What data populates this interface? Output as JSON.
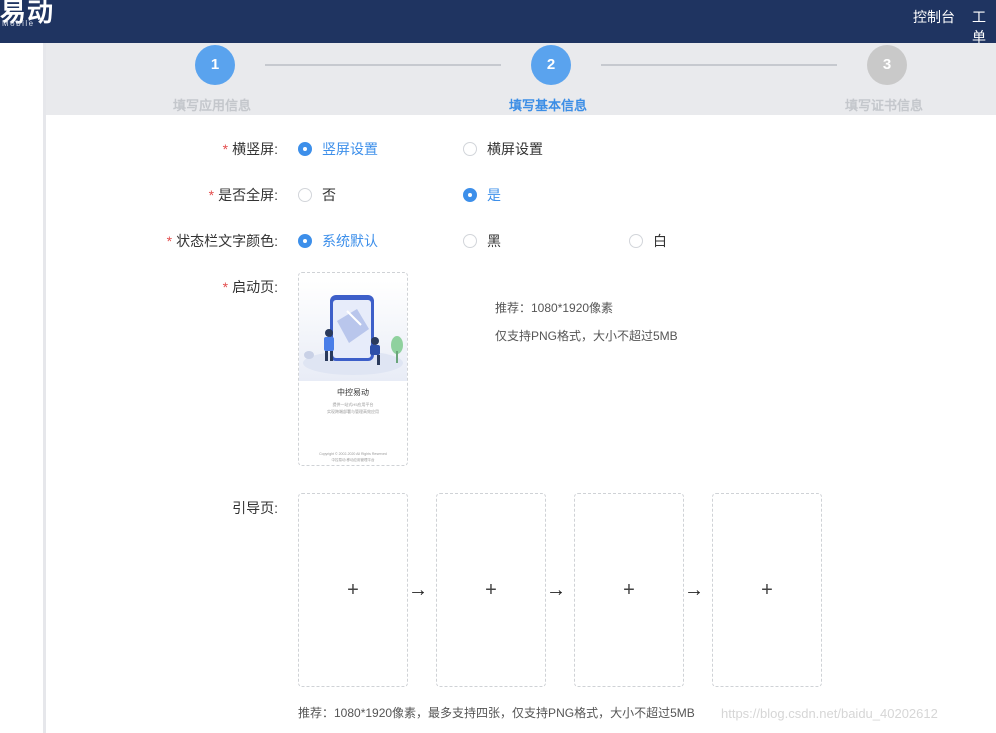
{
  "header": {
    "logo": "易动",
    "logo_sub": "Mobile",
    "nav": [
      "控制台",
      "工单"
    ]
  },
  "steps": [
    {
      "number": "1",
      "label": "填写应用信息",
      "state": "done"
    },
    {
      "number": "2",
      "label": "填写基本信息",
      "state": "current"
    },
    {
      "number": "3",
      "label": "填写证书信息",
      "state": "future"
    }
  ],
  "form": {
    "orientation": {
      "label": "横竖屏:",
      "options": [
        {
          "label": "竖屏设置",
          "checked": true
        },
        {
          "label": "横屏设置",
          "checked": false
        }
      ]
    },
    "fullscreen": {
      "label": "是否全屏:",
      "options": [
        {
          "label": "否",
          "checked": false
        },
        {
          "label": "是",
          "checked": true
        }
      ]
    },
    "statusbar": {
      "label": "状态栏文字颜色:",
      "options": [
        {
          "label": "系统默认",
          "checked": true
        },
        {
          "label": "黑",
          "checked": false
        },
        {
          "label": "白",
          "checked": false
        }
      ]
    },
    "splash": {
      "label": "启动页:",
      "preview_title": "中控易动",
      "preview_sub_1": "提供一站式H5应用平台",
      "preview_sub_2": "实现跨端部署与管理高效应用",
      "preview_copy_1": "Copyright © 2002-2020 All Rights Reserved",
      "preview_copy_2": "中控易动 移动应用管理平台",
      "hint_size": "推荐：1080*1920像素",
      "hint_format": "仅支持PNG格式，大小不超过5MB"
    },
    "guide": {
      "label": "引导页:",
      "plus": "+",
      "arrow": "→",
      "hint": "推荐：1080*1920像素，最多支持四张，仅支持PNG格式，大小不超过5MB"
    }
  },
  "watermark": "https://blog.csdn.net/baidu_40202612",
  "colors": {
    "header_bg": "#1f3461",
    "accent": "#3d8fea",
    "required": "#e34d4d"
  }
}
